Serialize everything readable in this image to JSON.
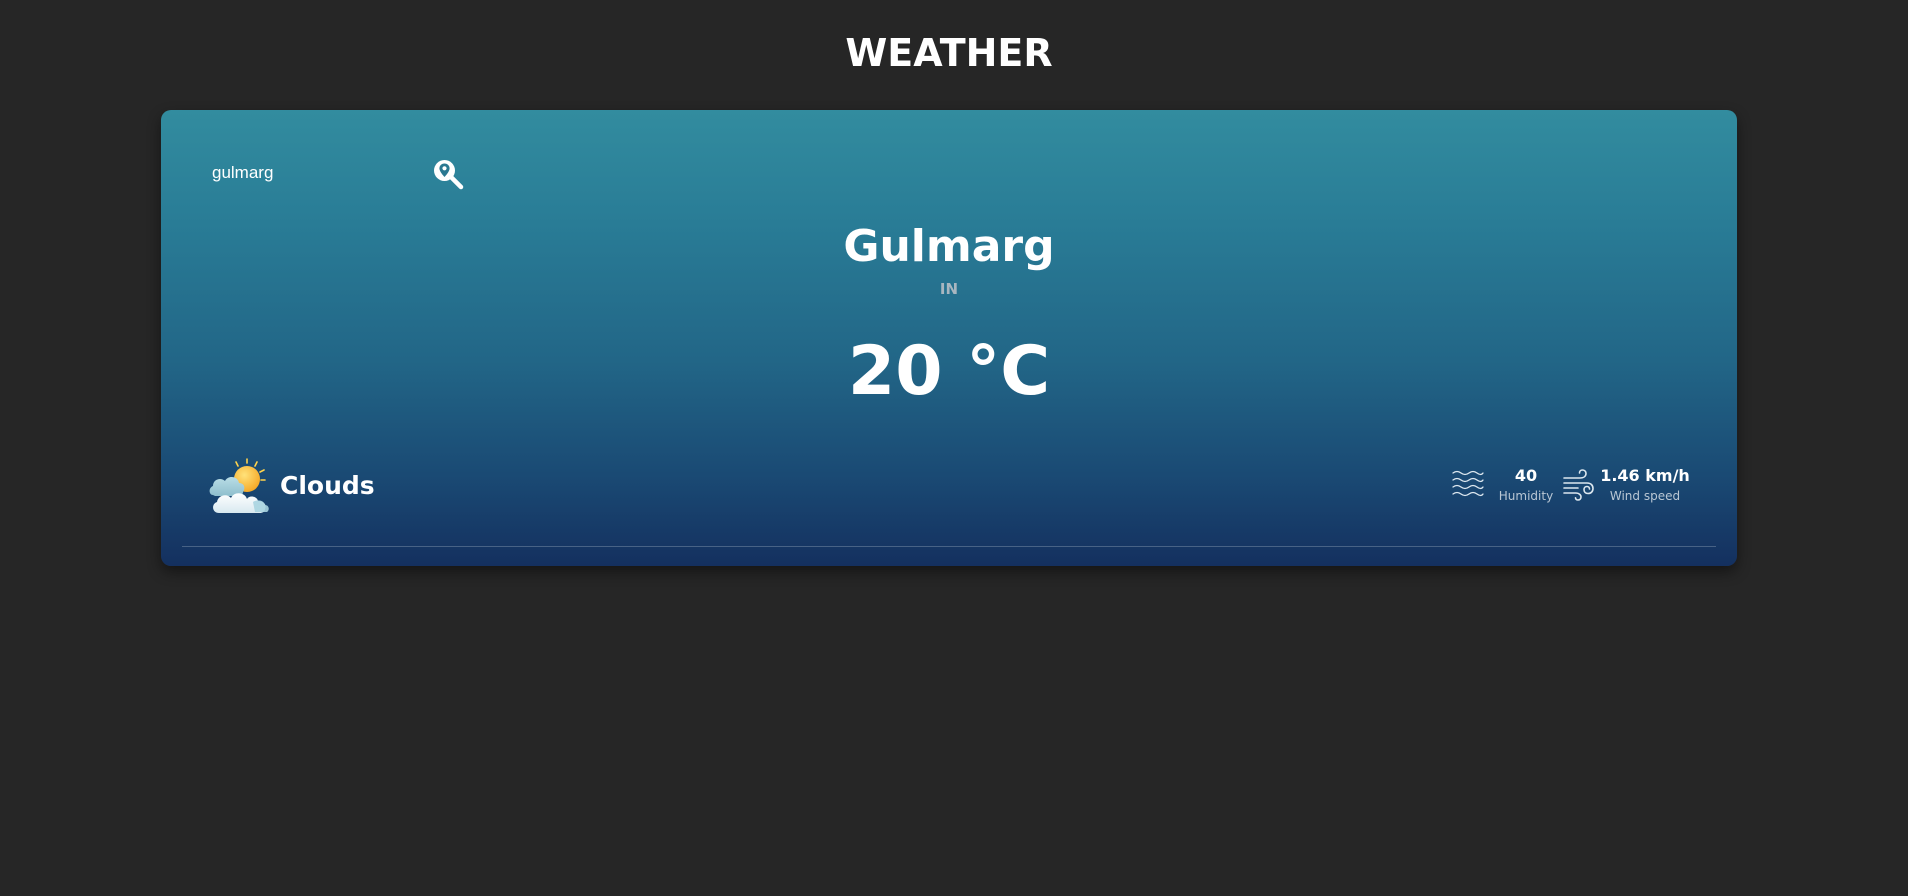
{
  "app": {
    "title": "WEATHER"
  },
  "search": {
    "value": "gulmarg",
    "placeholder": "",
    "button_icon": "location-search-icon"
  },
  "location": {
    "city": "Gulmarg",
    "country": "IN"
  },
  "weather": {
    "temperature": "20 °C",
    "condition": "Clouds",
    "condition_icon": "sun-behind-clouds-icon"
  },
  "stats": {
    "humidity": {
      "value": "40",
      "label": "Humidity",
      "icon": "waves-icon"
    },
    "wind": {
      "value": "1.46 km/h",
      "label": "Wind speed",
      "icon": "wind-icon"
    }
  },
  "colors": {
    "background": "#262626",
    "card_gradient_top": "#328c9f",
    "card_gradient_bottom": "#14305f",
    "text_primary": "#ffffff",
    "text_muted": "#a9b6c0"
  }
}
